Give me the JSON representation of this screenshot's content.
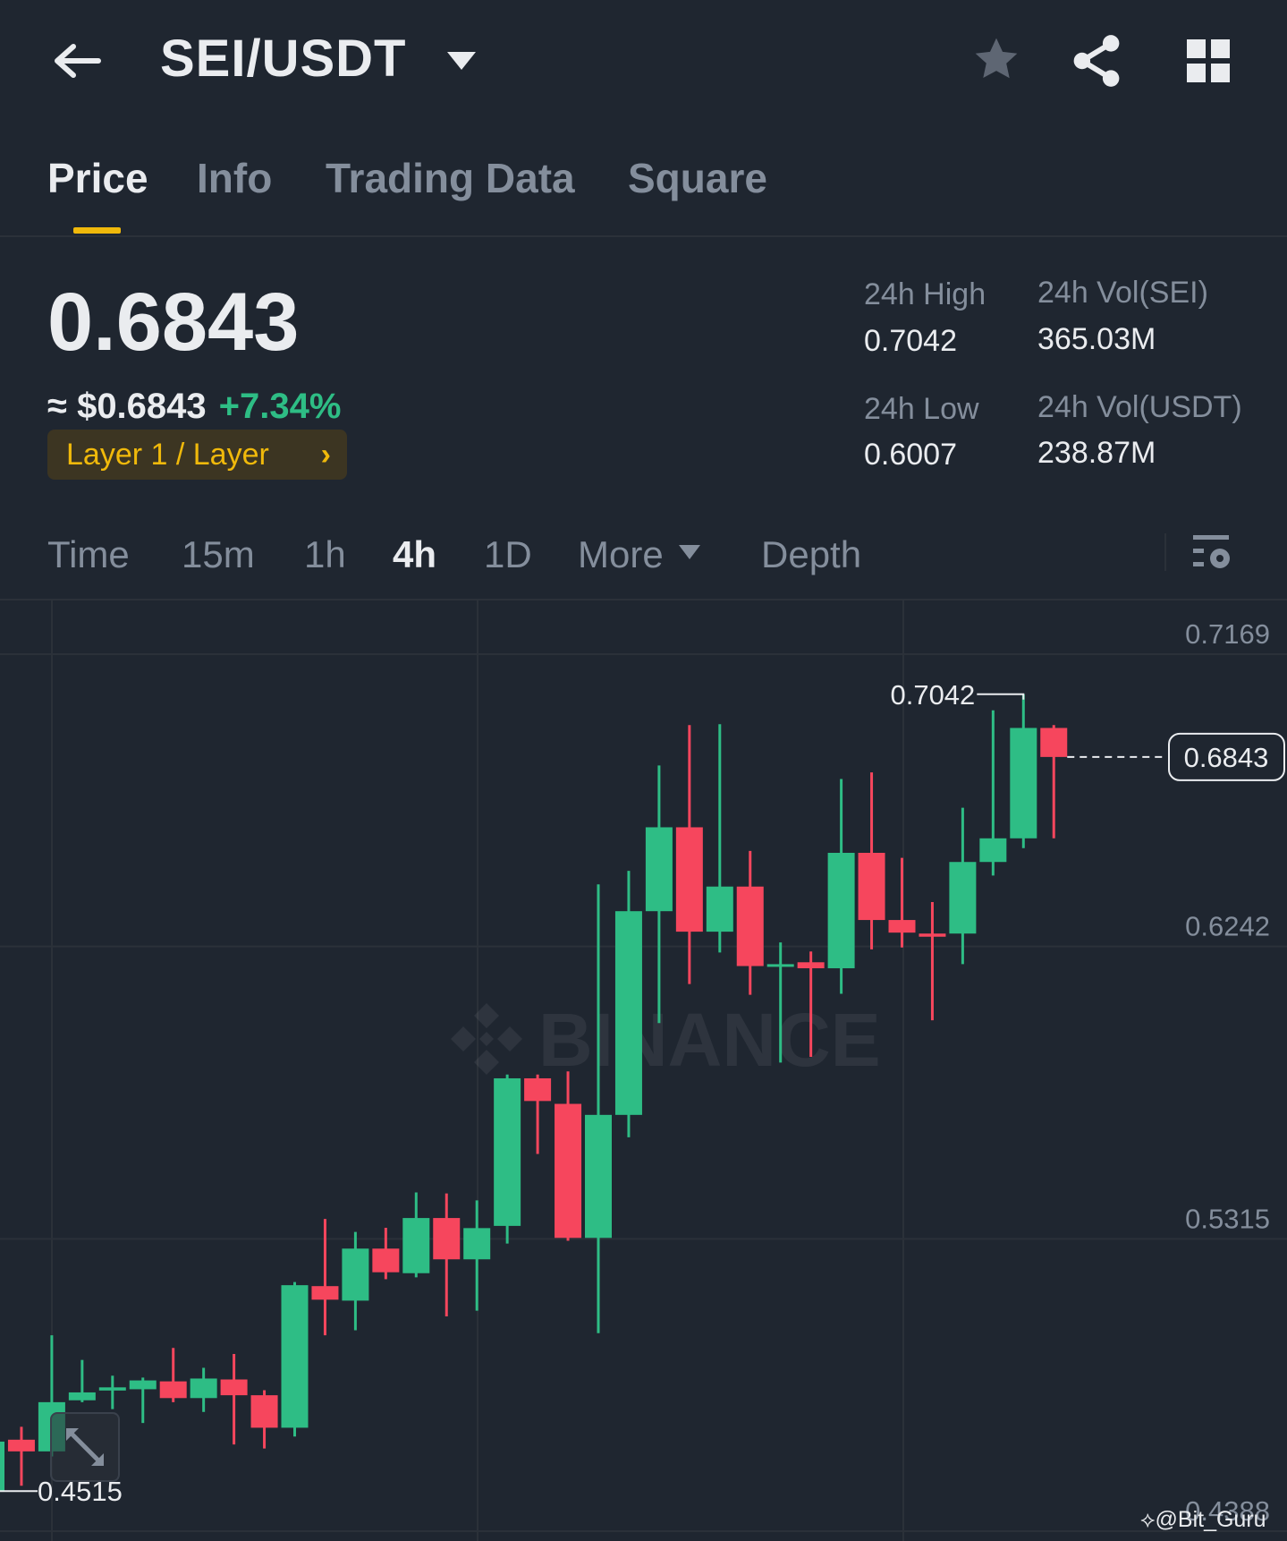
{
  "header": {
    "title": "SEI/USDT"
  },
  "tabs": [
    {
      "label": "Price"
    },
    {
      "label": "Info"
    },
    {
      "label": "Trading Data"
    },
    {
      "label": "Square"
    }
  ],
  "ticker": {
    "last_price": "0.6843",
    "approx_usd": "≈ $0.6843",
    "change_pct": "+7.34%",
    "category_tag": "Layer 1 / Layer",
    "stats": {
      "high_label": "24h High",
      "high_value": "0.7042",
      "low_label": "24h Low",
      "low_value": "0.6007",
      "vol_base_label": "24h Vol(SEI)",
      "vol_base_value": "365.03M",
      "vol_quote_label": "24h Vol(USDT)",
      "vol_quote_value": "238.87M"
    }
  },
  "intervals": [
    {
      "label": "Time"
    },
    {
      "label": "15m"
    },
    {
      "label": "1h"
    },
    {
      "label": "4h",
      "active": true
    },
    {
      "label": "1D"
    },
    {
      "label": "More"
    },
    {
      "label": "Depth"
    }
  ],
  "colors": {
    "up": "#2ebd85",
    "down": "#f6465d",
    "accent": "#f0b90b",
    "bg": "#1f2630"
  },
  "watermark": "BINANCE",
  "credit": "@Bit_Guru",
  "chart_data": {
    "type": "candlestick",
    "interval": "4h",
    "y_ticks": [
      "0.7169",
      "0.6242",
      "0.5315",
      "0.4388"
    ],
    "ylim": [
      0.4388,
      0.7169
    ],
    "high_marker": "0.7042",
    "low_marker": "0.4515",
    "current_price": "0.6843",
    "candles": [
      [
        0.4516,
        0.4672,
        0.4688,
        0.45
      ],
      [
        0.4678,
        0.4641,
        0.4719,
        0.4532
      ],
      [
        0.4641,
        0.4797,
        0.5009,
        0.4625
      ],
      [
        0.4803,
        0.4828,
        0.4931,
        0.4797
      ],
      [
        0.4834,
        0.4844,
        0.4881,
        0.4775
      ],
      [
        0.4838,
        0.4866,
        0.4875,
        0.4731
      ],
      [
        0.4863,
        0.481,
        0.4969,
        0.4797
      ],
      [
        0.481,
        0.4872,
        0.4906,
        0.4766
      ],
      [
        0.4869,
        0.4819,
        0.495,
        0.4663
      ],
      [
        0.4819,
        0.4716,
        0.4835,
        0.465
      ],
      [
        0.4716,
        0.5168,
        0.5178,
        0.4688
      ],
      [
        0.5165,
        0.5122,
        0.5378,
        0.5009
      ],
      [
        0.5119,
        0.5284,
        0.5337,
        0.5025
      ],
      [
        0.5284,
        0.5209,
        0.535,
        0.5187
      ],
      [
        0.5206,
        0.5381,
        0.5462,
        0.5193
      ],
      [
        0.5381,
        0.525,
        0.5459,
        0.5069
      ],
      [
        0.525,
        0.5349,
        0.5437,
        0.5087
      ],
      [
        0.5356,
        0.5824,
        0.5836,
        0.53
      ],
      [
        0.5824,
        0.5752,
        0.5836,
        0.5584
      ],
      [
        0.5743,
        0.5318,
        0.5846,
        0.5309
      ],
      [
        0.5318,
        0.5708,
        0.6439,
        0.5016
      ],
      [
        0.5708,
        0.6354,
        0.6482,
        0.5637
      ],
      [
        0.6354,
        0.662,
        0.6816,
        0.5999
      ],
      [
        0.662,
        0.6289,
        0.6944,
        0.6123
      ],
      [
        0.6289,
        0.6432,
        0.6947,
        0.6223
      ],
      [
        0.6432,
        0.618,
        0.6545,
        0.6089
      ],
      [
        0.618,
        0.6186,
        0.6255,
        0.5874
      ],
      [
        0.6192,
        0.6173,
        0.6226,
        0.5892
      ],
      [
        0.6173,
        0.6539,
        0.6773,
        0.6092
      ],
      [
        0.6539,
        0.6326,
        0.6794,
        0.6233
      ],
      [
        0.6326,
        0.6286,
        0.6523,
        0.6239
      ],
      [
        0.6283,
        0.6273,
        0.6383,
        0.6008
      ],
      [
        0.6283,
        0.651,
        0.6682,
        0.6186
      ],
      [
        0.651,
        0.6585,
        0.6991,
        0.6467
      ],
      [
        0.6585,
        0.6935,
        0.7042,
        0.6554
      ],
      [
        0.6935,
        0.6843,
        0.6944,
        0.6585
      ]
    ]
  }
}
